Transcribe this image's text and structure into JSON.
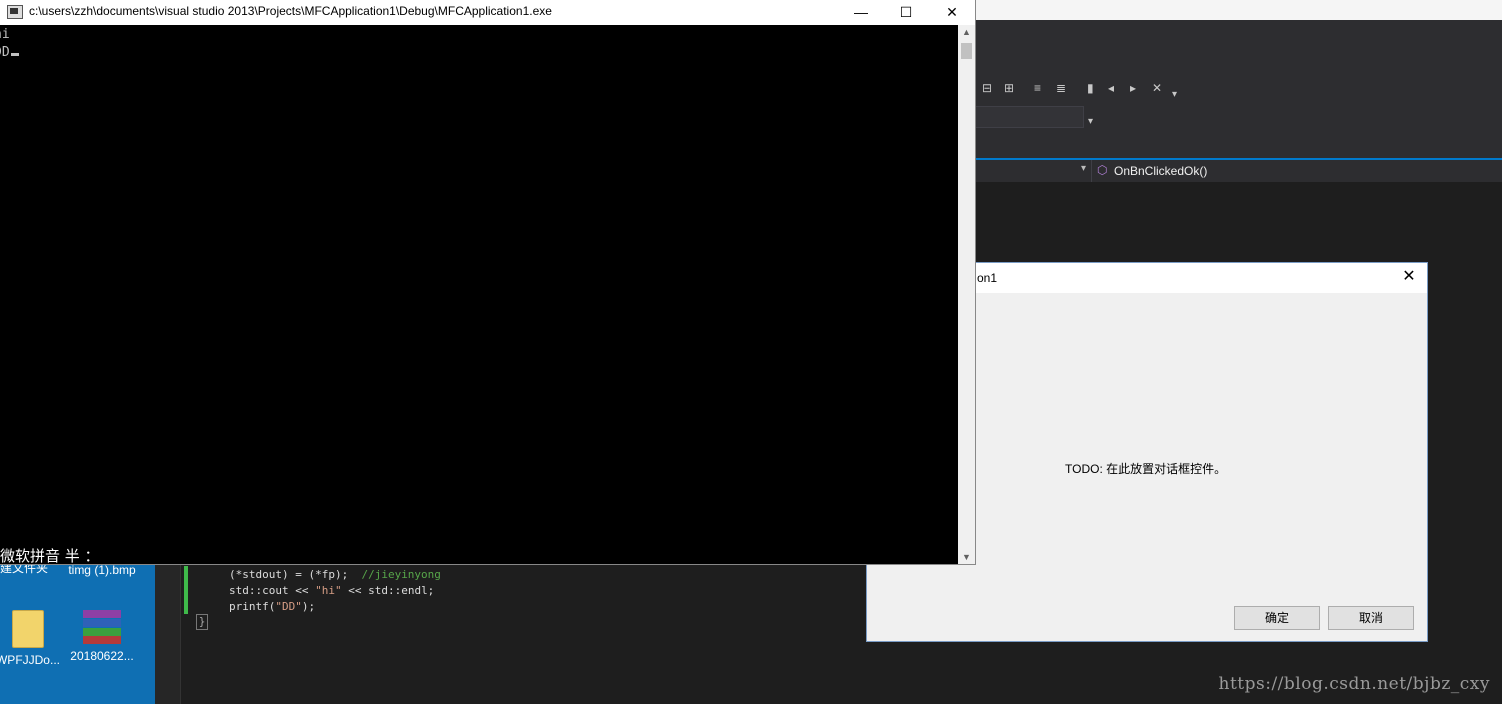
{
  "console": {
    "title": "c:\\users\\zzh\\documents\\visual studio 2013\\Projects\\MFCApplication1\\Debug\\MFCApplication1.exe",
    "lines": [
      "hi",
      "DD"
    ],
    "ime_status": "微软拼音 半 ：",
    "controls": {
      "minimize": "—",
      "maximize": "☐",
      "close": "✕"
    }
  },
  "vs": {
    "nav_method": "OnBnClickedOk()",
    "code": {
      "line1_code": "(*stdout) = (*fp);  ",
      "line1_comment": "//jieyinyong",
      "line2_a": "std::cout << ",
      "line2_str": "\"hi\"",
      "line2_b": " << std::endl;",
      "line3_a": "printf(",
      "line3_str": "\"DD\"",
      "line3_b": ");",
      "brace": "}"
    }
  },
  "dialog": {
    "title": "on1",
    "close": "✕",
    "static_text": "TODO:  在此放置对话框控件。",
    "ok_label": "确定",
    "cancel_label": "取消"
  },
  "desktop": {
    "icons": [
      {
        "label": "新建文件夹",
        "icon": "folder-icon"
      },
      {
        "label": "timg (1).bmp",
        "icon": "image-file-icon"
      },
      {
        "label": "WPFJJDo...",
        "icon": "folder-icon"
      },
      {
        "label": "20180622...",
        "icon": "winrar-archive-icon"
      }
    ]
  },
  "watermark": "https://blog.csdn.net/bjbz_cxy"
}
